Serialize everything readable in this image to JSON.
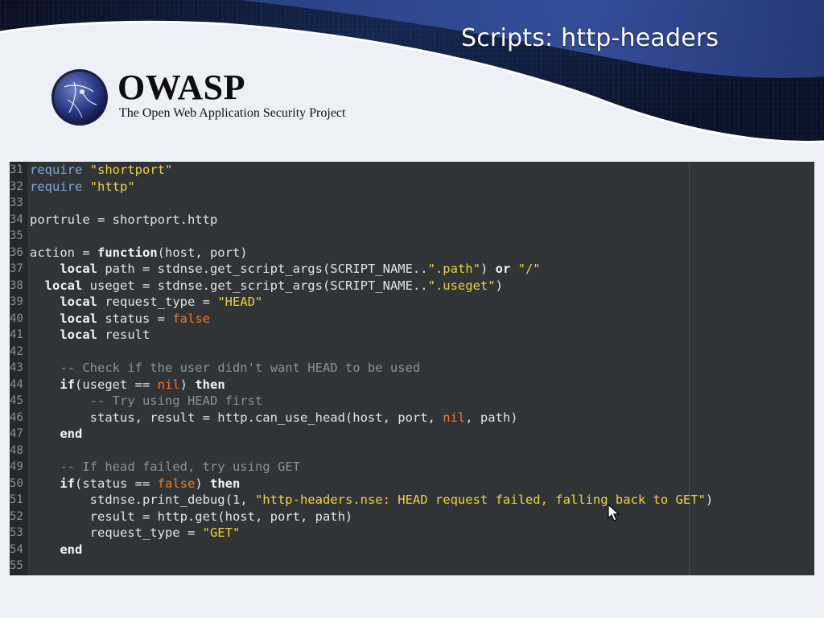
{
  "slide": {
    "title": "Scripts: http-headers"
  },
  "logo": {
    "name": "OWASP",
    "tagline": "The Open Web Application Security Project"
  },
  "colors": {
    "banner_dark": "#0b1120",
    "banner_blue": "#273c7c",
    "editor_bg": "#313437",
    "keyword": "#f4f4f4",
    "require": "#7ca8d8",
    "string": "#ecd33c",
    "constant": "#f0781e",
    "comment": "#8b9196"
  },
  "code": {
    "lines": [
      {
        "num": "31",
        "tokens": [
          {
            "t": "req",
            "v": "require"
          },
          {
            "t": "pl",
            "v": " "
          },
          {
            "t": "str",
            "v": "\"shortport\""
          }
        ]
      },
      {
        "num": "32",
        "tokens": [
          {
            "t": "req",
            "v": "require"
          },
          {
            "t": "pl",
            "v": " "
          },
          {
            "t": "str",
            "v": "\"http\""
          }
        ]
      },
      {
        "num": "33",
        "tokens": []
      },
      {
        "num": "34",
        "tokens": [
          {
            "t": "pl",
            "v": "portrule = shortport.http"
          }
        ]
      },
      {
        "num": "35",
        "tokens": []
      },
      {
        "num": "36",
        "tokens": [
          {
            "t": "pl",
            "v": "action = "
          },
          {
            "t": "kw",
            "v": "function"
          },
          {
            "t": "pl",
            "v": "(host, port)"
          }
        ]
      },
      {
        "num": "37",
        "tokens": [
          {
            "t": "pl",
            "v": "    "
          },
          {
            "t": "kw",
            "v": "local"
          },
          {
            "t": "pl",
            "v": " path = stdnse.get_script_args(SCRIPT_NAME.."
          },
          {
            "t": "str",
            "v": "\".path\""
          },
          {
            "t": "pl",
            "v": ") "
          },
          {
            "t": "kw",
            "v": "or"
          },
          {
            "t": "pl",
            "v": " "
          },
          {
            "t": "str",
            "v": "\"/\""
          }
        ]
      },
      {
        "num": "38",
        "tokens": [
          {
            "t": "pl",
            "v": "  "
          },
          {
            "t": "kw",
            "v": "local"
          },
          {
            "t": "pl",
            "v": " useget = stdnse.get_script_args(SCRIPT_NAME.."
          },
          {
            "t": "str",
            "v": "\".useget\""
          },
          {
            "t": "pl",
            "v": ")"
          }
        ]
      },
      {
        "num": "39",
        "tokens": [
          {
            "t": "pl",
            "v": "    "
          },
          {
            "t": "kw",
            "v": "local"
          },
          {
            "t": "pl",
            "v": " request_type = "
          },
          {
            "t": "str",
            "v": "\"HEAD\""
          }
        ]
      },
      {
        "num": "40",
        "tokens": [
          {
            "t": "pl",
            "v": "    "
          },
          {
            "t": "kw",
            "v": "local"
          },
          {
            "t": "pl",
            "v": " status = "
          },
          {
            "t": "cst",
            "v": "false"
          }
        ]
      },
      {
        "num": "41",
        "tokens": [
          {
            "t": "pl",
            "v": "    "
          },
          {
            "t": "kw",
            "v": "local"
          },
          {
            "t": "pl",
            "v": " result"
          }
        ]
      },
      {
        "num": "42",
        "tokens": []
      },
      {
        "num": "43",
        "tokens": [
          {
            "t": "pl",
            "v": "    "
          },
          {
            "t": "cmt",
            "v": "-- Check if the user didn't want HEAD to be used"
          }
        ]
      },
      {
        "num": "44",
        "tokens": [
          {
            "t": "pl",
            "v": "    "
          },
          {
            "t": "kw",
            "v": "if"
          },
          {
            "t": "pl",
            "v": "(useget == "
          },
          {
            "t": "cst",
            "v": "nil"
          },
          {
            "t": "pl",
            "v": ") "
          },
          {
            "t": "kw",
            "v": "then"
          }
        ]
      },
      {
        "num": "45",
        "tokens": [
          {
            "t": "pl",
            "v": "        "
          },
          {
            "t": "cmt",
            "v": "-- Try using HEAD first"
          }
        ]
      },
      {
        "num": "46",
        "tokens": [
          {
            "t": "pl",
            "v": "        status, result = http.can_use_head(host, port, "
          },
          {
            "t": "cst",
            "v": "nil"
          },
          {
            "t": "pl",
            "v": ", path)"
          }
        ]
      },
      {
        "num": "47",
        "tokens": [
          {
            "t": "pl",
            "v": "    "
          },
          {
            "t": "kw",
            "v": "end"
          }
        ]
      },
      {
        "num": "48",
        "tokens": []
      },
      {
        "num": "49",
        "tokens": [
          {
            "t": "pl",
            "v": "    "
          },
          {
            "t": "cmt",
            "v": "-- If head failed, try using GET"
          }
        ]
      },
      {
        "num": "50",
        "tokens": [
          {
            "t": "pl",
            "v": "    "
          },
          {
            "t": "kw",
            "v": "if"
          },
          {
            "t": "pl",
            "v": "(status == "
          },
          {
            "t": "cst",
            "v": "false"
          },
          {
            "t": "pl",
            "v": ") "
          },
          {
            "t": "kw",
            "v": "then"
          }
        ]
      },
      {
        "num": "51",
        "tokens": [
          {
            "t": "pl",
            "v": "        stdnse.print_debug(1, "
          },
          {
            "t": "str",
            "v": "\"http-headers.nse: HEAD request failed, falling back to GET\""
          },
          {
            "t": "pl",
            "v": ")"
          }
        ]
      },
      {
        "num": "52",
        "tokens": [
          {
            "t": "pl",
            "v": "        result = http.get(host, port, path)"
          }
        ]
      },
      {
        "num": "53",
        "tokens": [
          {
            "t": "pl",
            "v": "        request_type = "
          },
          {
            "t": "str",
            "v": "\"GET\""
          }
        ]
      },
      {
        "num": "54",
        "tokens": [
          {
            "t": "pl",
            "v": "    "
          },
          {
            "t": "kw",
            "v": "end"
          }
        ]
      },
      {
        "num": "55",
        "tokens": []
      }
    ]
  }
}
